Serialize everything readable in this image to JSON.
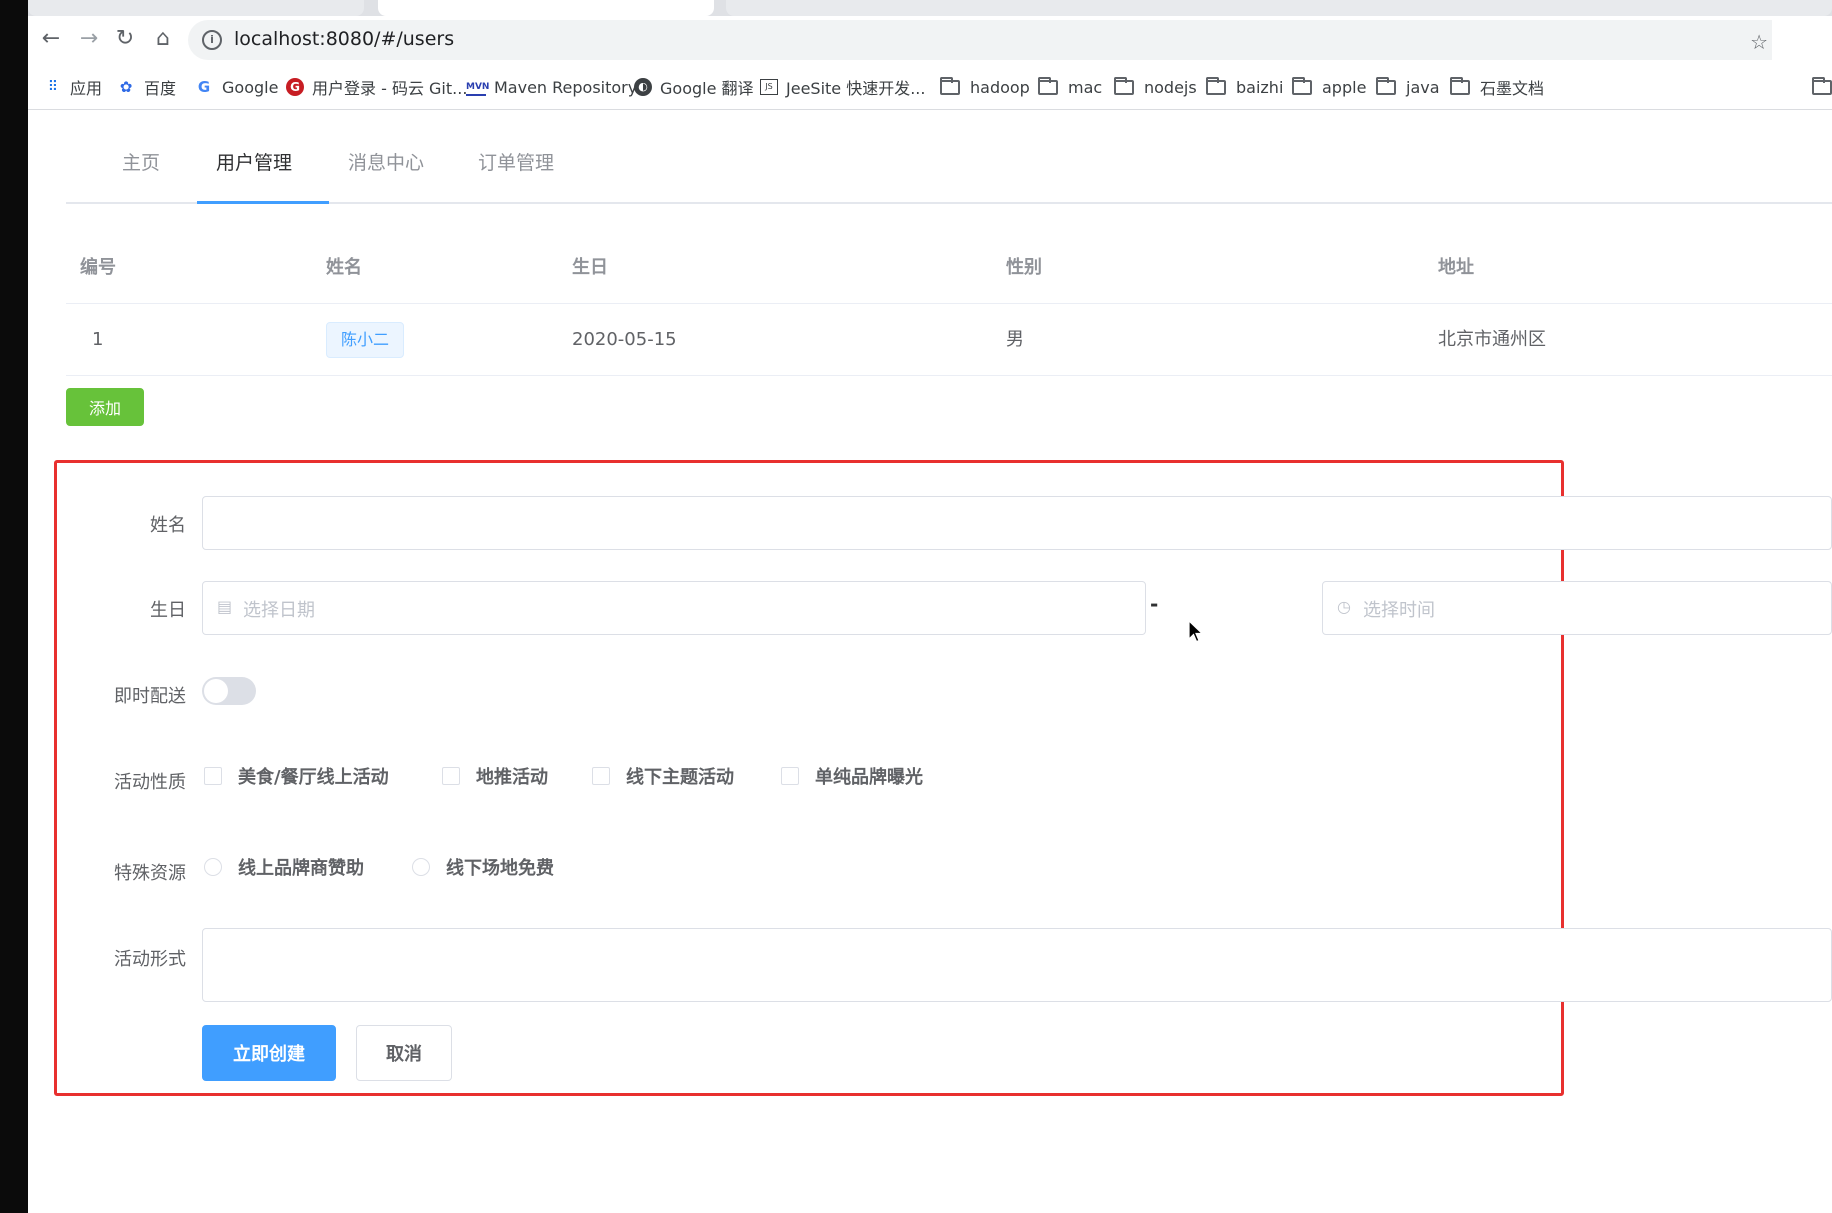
{
  "browser": {
    "url": "localhost:8080/#/users",
    "bookmarks": [
      {
        "label": "应用",
        "icon": "apps-grid-icon"
      },
      {
        "label": "百度",
        "icon": "baidu-paw-icon"
      },
      {
        "label": "Google",
        "icon": "google-icon"
      },
      {
        "label": "用户登录 - 码云 Git...",
        "icon": "gitee-icon"
      },
      {
        "label": "Maven Repository",
        "icon": "mvn-icon"
      },
      {
        "label": "Google 翻译",
        "icon": "google-translate-icon"
      },
      {
        "label": "JeeSite 快速开发...",
        "icon": "js-icon"
      },
      {
        "label": "hadoop",
        "icon": "folder-icon"
      },
      {
        "label": "mac",
        "icon": "folder-icon"
      },
      {
        "label": "nodejs",
        "icon": "folder-icon"
      },
      {
        "label": "baizhi",
        "icon": "folder-icon"
      },
      {
        "label": "apple",
        "icon": "folder-icon"
      },
      {
        "label": "java",
        "icon": "folder-icon"
      },
      {
        "label": "石墨文档",
        "icon": "folder-icon"
      }
    ]
  },
  "tabs": [
    {
      "label": "主页",
      "active": false
    },
    {
      "label": "用户管理",
      "active": true
    },
    {
      "label": "消息中心",
      "active": false
    },
    {
      "label": "订单管理",
      "active": false
    }
  ],
  "table": {
    "headers": [
      "编号",
      "姓名",
      "生日",
      "性别",
      "地址"
    ],
    "rows": [
      {
        "id": "1",
        "name": "陈小二",
        "birthday": "2020-05-15",
        "gender": "男",
        "address": "北京市通州区"
      }
    ]
  },
  "add_button": "添加",
  "form": {
    "name_label": "姓名",
    "name_value": "",
    "birthday_label": "生日",
    "date_placeholder": "选择日期",
    "range_separator": "-",
    "time_placeholder": "选择时间",
    "delivery_label": "即时配送",
    "delivery_on": false,
    "type_label": "活动性质",
    "type_options": [
      "美食/餐厅线上活动",
      "地推活动",
      "线下主题活动",
      "单纯品牌曝光"
    ],
    "resource_label": "特殊资源",
    "resource_options": [
      "线上品牌商赞助",
      "线下场地免费"
    ],
    "form_label": "活动形式",
    "form_value": "",
    "submit": "立即创建",
    "cancel": "取消"
  },
  "colors": {
    "primary": "#409eff",
    "success": "#67c23a",
    "highlight_frame": "#e8302f"
  }
}
